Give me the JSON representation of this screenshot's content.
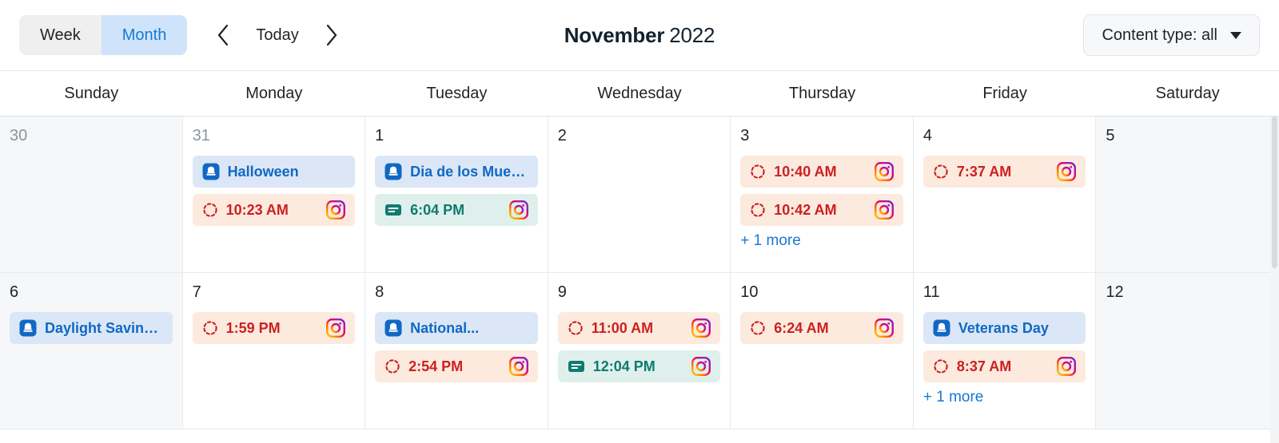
{
  "toolbar": {
    "view_week_label": "Week",
    "view_month_label": "Month",
    "today_label": "Today",
    "prev_icon": "chevron-left-icon",
    "next_icon": "chevron-right-icon",
    "title_month": "November",
    "title_year": "2022",
    "filter_label": "Content type: all",
    "filter_caret_icon": "chevron-down-icon"
  },
  "weekdays": [
    "Sunday",
    "Monday",
    "Tuesday",
    "Wednesday",
    "Thursday",
    "Friday",
    "Saturday"
  ],
  "colors": {
    "accent_blue": "#1878d1",
    "holiday_bg": "#dbe7f6",
    "holiday_text": "#1068c4",
    "scheduled_bg": "#fdeade",
    "scheduled_text": "#cc2020",
    "published_bg": "#dff0ec",
    "published_text": "#0f7a70",
    "weekend_bg": "#f5f7f9",
    "grid_line": "#e6eaee"
  },
  "days": [
    {
      "num": "30",
      "muted": true,
      "weekend": true,
      "events": [],
      "more": null
    },
    {
      "num": "31",
      "muted": true,
      "weekend": false,
      "events": [
        {
          "type": "holiday",
          "icon": "holiday-bell-icon",
          "label": "Halloween",
          "channel": null
        },
        {
          "type": "scheduled",
          "icon": "pending-circle-icon",
          "label": "10:23 AM",
          "channel": "instagram-icon"
        }
      ],
      "more": null
    },
    {
      "num": "1",
      "muted": false,
      "weekend": false,
      "events": [
        {
          "type": "holiday",
          "icon": "holiday-bell-icon",
          "label": "Dia de los Muertos",
          "channel": null
        },
        {
          "type": "published",
          "icon": "published-post-icon",
          "label": "6:04 PM",
          "channel": "instagram-icon"
        }
      ],
      "more": null
    },
    {
      "num": "2",
      "muted": false,
      "weekend": false,
      "events": [],
      "more": null
    },
    {
      "num": "3",
      "muted": false,
      "weekend": false,
      "events": [
        {
          "type": "scheduled",
          "icon": "pending-circle-icon",
          "label": "10:40 AM",
          "channel": "instagram-icon"
        },
        {
          "type": "scheduled",
          "icon": "pending-circle-icon",
          "label": "10:42 AM",
          "channel": "instagram-icon"
        }
      ],
      "more": "+ 1 more"
    },
    {
      "num": "4",
      "muted": false,
      "weekend": false,
      "events": [
        {
          "type": "scheduled",
          "icon": "pending-circle-icon",
          "label": "7:37 AM",
          "channel": "instagram-icon"
        }
      ],
      "more": null
    },
    {
      "num": "5",
      "muted": false,
      "weekend": true,
      "events": [],
      "more": null
    },
    {
      "num": "6",
      "muted": false,
      "weekend": true,
      "events": [
        {
          "type": "holiday",
          "icon": "holiday-bell-icon",
          "label": "Daylight Saving...",
          "channel": null
        }
      ],
      "more": null
    },
    {
      "num": "7",
      "muted": false,
      "weekend": false,
      "events": [
        {
          "type": "scheduled",
          "icon": "pending-circle-icon",
          "label": "1:59 PM",
          "channel": "instagram-icon"
        }
      ],
      "more": null
    },
    {
      "num": "8",
      "muted": false,
      "weekend": false,
      "events": [
        {
          "type": "holiday",
          "icon": "holiday-bell-icon",
          "label": "National...",
          "channel": null
        },
        {
          "type": "scheduled",
          "icon": "pending-circle-icon",
          "label": "2:54 PM",
          "channel": "instagram-icon"
        }
      ],
      "more": null
    },
    {
      "num": "9",
      "muted": false,
      "weekend": false,
      "events": [
        {
          "type": "scheduled",
          "icon": "pending-circle-icon",
          "label": "11:00 AM",
          "channel": "instagram-icon"
        },
        {
          "type": "published",
          "icon": "published-post-icon",
          "label": "12:04 PM",
          "channel": "instagram-icon"
        }
      ],
      "more": null
    },
    {
      "num": "10",
      "muted": false,
      "weekend": false,
      "events": [
        {
          "type": "scheduled",
          "icon": "pending-circle-icon",
          "label": "6:24 AM",
          "channel": "instagram-icon"
        }
      ],
      "more": null
    },
    {
      "num": "11",
      "muted": false,
      "weekend": false,
      "events": [
        {
          "type": "holiday",
          "icon": "holiday-bell-icon",
          "label": "Veterans Day",
          "channel": null
        },
        {
          "type": "scheduled",
          "icon": "pending-circle-icon",
          "label": "8:37 AM",
          "channel": "instagram-icon"
        }
      ],
      "more": "+ 1 more"
    },
    {
      "num": "12",
      "muted": false,
      "weekend": true,
      "events": [],
      "more": null
    }
  ]
}
